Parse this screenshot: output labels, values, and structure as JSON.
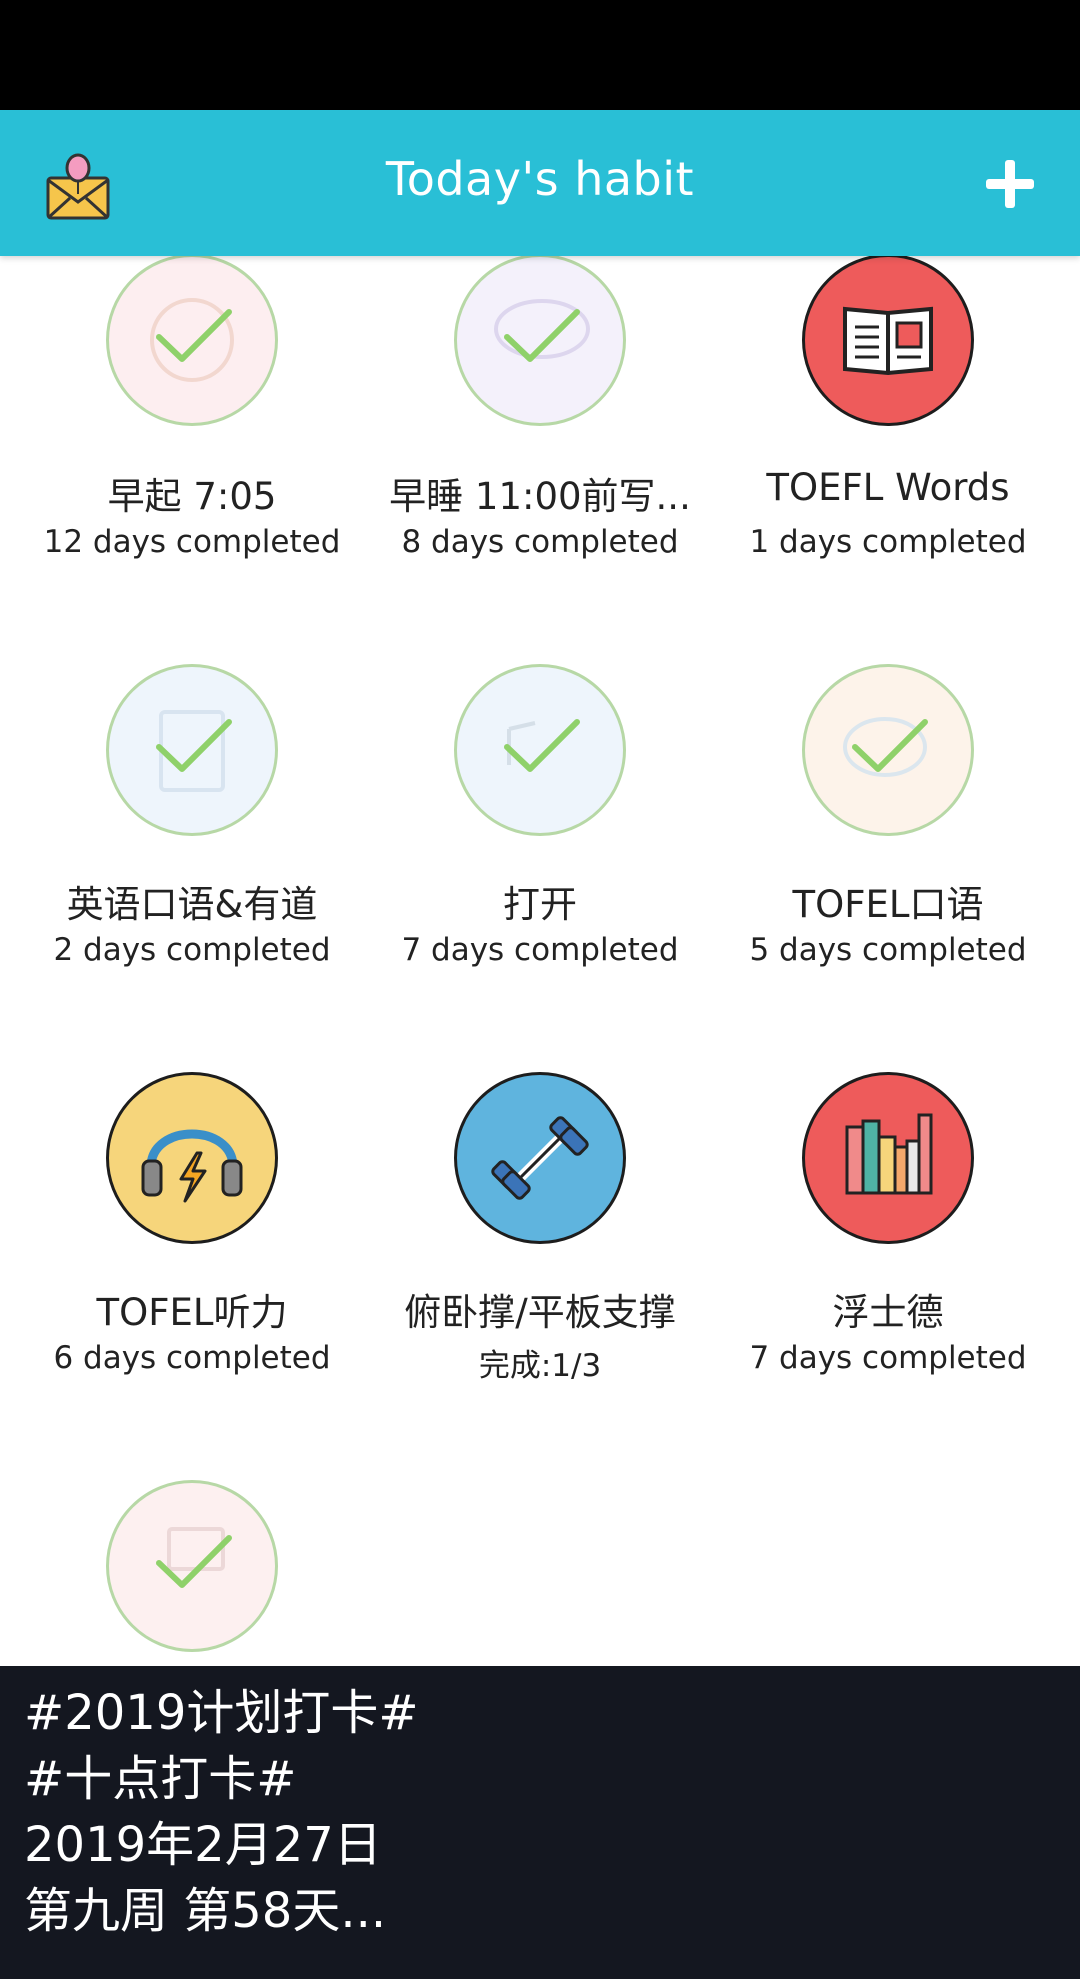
{
  "app_bar": {
    "title": "Today's habit",
    "left_icon": "mail-balloon-icon",
    "right_icon": "plus-icon"
  },
  "colors": {
    "accent": "#29bfd6",
    "done_ring": "#b7d8a6",
    "check": "#8fd16a",
    "caption_bg": "#141720"
  },
  "habits": [
    {
      "name": "早起 7:05",
      "progress": "12 days completed",
      "icon": "smiley-face-icon",
      "done": true
    },
    {
      "name": "早睡 11:00前写...",
      "progress": "8 days completed",
      "icon": "sleep-cloud-icon",
      "done": true
    },
    {
      "name": "TOEFL Words",
      "progress": "1 days completed",
      "icon": "open-book-icon",
      "done": false
    },
    {
      "name": "英语口语&有道",
      "progress": "2 days completed",
      "icon": "notebook-icon",
      "done": true
    },
    {
      "name": "打开",
      "progress": "7 days completed",
      "icon": "music-notes-icon",
      "done": true
    },
    {
      "name": "TOFEL口语",
      "progress": "5 days completed",
      "icon": "speech-bubbles-icon",
      "done": true
    },
    {
      "name": "TOFEL听力",
      "progress": "6 days completed",
      "icon": "headphones-icon",
      "done": false
    },
    {
      "name": "俯卧撑/平板支撑",
      "progress": "完成:1/3",
      "icon": "dumbbell-icon",
      "done": false
    },
    {
      "name": "浮士德",
      "progress": "7 days completed",
      "icon": "books-icon",
      "done": false
    },
    {
      "icon": "desk-computer-icon",
      "done": true
    }
  ],
  "caption": {
    "lines": [
      "#2019计划打卡#",
      "#十点打卡#",
      "2019年2月27日",
      "第九周 第58天..."
    ]
  }
}
